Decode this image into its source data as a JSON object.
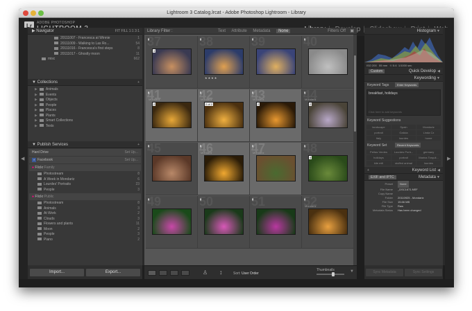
{
  "window": {
    "title": "Lightroom 3 Catalog.lrcat - Adobe Photoshop Lightroom - Library"
  },
  "identity": {
    "logo": "Lr",
    "brand_small": "ADOBE PHOTOSHOP",
    "brand_large": "LIGHTROOM 3"
  },
  "modules": [
    "Library",
    "Develop",
    "Slideshow",
    "Print",
    "Web"
  ],
  "active_module": "Library",
  "navigator": {
    "title": "Navigator",
    "zoom_options": "FIT FILL 1:1 3:1"
  },
  "folders": [
    {
      "name": "20111007 - Francesca at Winnie",
      "count": "1"
    },
    {
      "name": "20111009 - Walking to Las Ro...",
      "count": "54"
    },
    {
      "name": "20111016 - Francesca's first steps",
      "count": "8"
    },
    {
      "name": "20111017 - Ghostly moon",
      "count": "11"
    },
    {
      "name": "misc",
      "count": "662"
    }
  ],
  "collections": {
    "title": "Collections",
    "items": [
      "Animals",
      "Events",
      "Objects",
      "People",
      "Places",
      "Plants",
      "Smart Collections",
      "Tests"
    ]
  },
  "publish": {
    "title": "Publish Services",
    "setup": "Set Up...",
    "services": [
      "Hard Drive",
      "Facebook"
    ],
    "flickr_family": {
      "label": "Flickr",
      "sub": "Family",
      "items": [
        {
          "name": "Photostream",
          "count": "8"
        },
        {
          "name": "A Week in Mondariz",
          "count": "6"
        },
        {
          "name": "Lourdes' Portraits",
          "count": "23"
        },
        {
          "name": "People",
          "count": "3"
        }
      ]
    },
    "flickr_public": {
      "label": "Flickr",
      "sub": "Public",
      "items": [
        {
          "name": "Photostream",
          "count": "8"
        },
        {
          "name": "Animals",
          "count": "3"
        },
        {
          "name": "At Work",
          "count": "2"
        },
        {
          "name": "Clouds",
          "count": "3"
        },
        {
          "name": "Flowers and plants",
          "count": "11"
        },
        {
          "name": "Moon",
          "count": "2"
        },
        {
          "name": "People",
          "count": "3"
        },
        {
          "name": "Piano",
          "count": "2"
        }
      ]
    }
  },
  "buttons": {
    "import": "Import...",
    "export": "Export...",
    "sync_metadata": "Sync Metadata",
    "sync_settings": "Sync Settings"
  },
  "filter": {
    "label": "Library Filter :",
    "options": [
      "Text",
      "Attribute",
      "Metadata",
      "None"
    ],
    "selected": "None",
    "off": "Filters Off"
  },
  "grid": [
    {
      "n": "37",
      "c1": "#3a3a52",
      "c2": "#c89060",
      "sel": false,
      "badge": "4",
      "cap": "",
      "stars": "",
      "mark": false
    },
    {
      "n": "38",
      "c1": "#2c3c6a",
      "c2": "#e0a050",
      "sel": false,
      "badge": "",
      "cap": "",
      "stars": "★★★★",
      "mark": false
    },
    {
      "n": "39",
      "c1": "#3a4478",
      "c2": "#e0b060",
      "sel": false,
      "badge": "",
      "cap": "",
      "stars": "",
      "mark": false
    },
    {
      "n": "40",
      "c1": "#8a8a8a",
      "c2": "#c0c0c0",
      "sel": false,
      "badge": "",
      "cap": "",
      "stars": "",
      "mark": true
    },
    {
      "n": "41",
      "c1": "#3a2810",
      "c2": "#e8a838",
      "sel": true,
      "badge": "2",
      "cap": "Mondariz",
      "stars": "",
      "mark": false
    },
    {
      "n": "42",
      "c1": "#4a3010",
      "c2": "#f0b040",
      "sel": true,
      "badge": "2 of 2",
      "cap": "Mondariz",
      "stars": "",
      "mark": false
    },
    {
      "n": "43",
      "c1": "#2a1a08",
      "c2": "#e89830",
      "sel": true,
      "badge": "2",
      "cap": "Mondariz",
      "stars": "",
      "mark": false
    },
    {
      "n": "44",
      "c1": "#4a4438",
      "c2": "#b8a8c8",
      "sel": false,
      "badge": "2",
      "cap": "Mondariz",
      "stars": "",
      "mark": false
    },
    {
      "n": "45",
      "c1": "#5a3828",
      "c2": "#b88868",
      "sel": false,
      "badge": "",
      "cap": "",
      "stars": "",
      "mark": false
    },
    {
      "n": "46",
      "c1": "#2a1c08",
      "c2": "#f0a830",
      "sel": true,
      "badge": "",
      "cap": "Mondariz",
      "stars": "",
      "mark": false
    },
    {
      "n": "47",
      "c1": "#6a5030",
      "c2": "#4a6a30",
      "sel": true,
      "badge": "",
      "cap": "Mondariz",
      "stars": "",
      "mark": false
    },
    {
      "n": "48",
      "c1": "#2a4a1a",
      "c2": "#6a8a3a",
      "sel": false,
      "badge": "4",
      "cap": "",
      "stars": "",
      "mark": false
    },
    {
      "n": "49",
      "c1": "#1a4a1a",
      "c2": "#c848a8",
      "sel": false,
      "badge": "",
      "cap": "",
      "stars": "",
      "mark": false
    },
    {
      "n": "50",
      "c1": "#1a3a1a",
      "c2": "#d858b8",
      "sel": false,
      "badge": "",
      "cap": "",
      "stars": "",
      "mark": false
    },
    {
      "n": "51",
      "c1": "#183a18",
      "c2": "#b838a0",
      "sel": false,
      "badge": "",
      "cap": "",
      "stars": "",
      "mark": false
    },
    {
      "n": "52",
      "c1": "#4a3010",
      "c2": "#e8a040",
      "sel": false,
      "badge": "",
      "cap": "Mondariz",
      "stars": "",
      "mark": false
    }
  ],
  "toolbar": {
    "sort_label": "Sort:",
    "sort_value": "User Order",
    "thumbnails": "Thumbnails"
  },
  "histogram": {
    "title": "Histogram",
    "iso": "ISO 200",
    "focal": "55 mm",
    "aperture": "f / 5.6",
    "shutter": "1/1000 sec"
  },
  "quick_develop": {
    "title": "Quick Develop",
    "preset": "Custom"
  },
  "keywording": {
    "title": "Keywording",
    "tags_label": "Keyword Tags",
    "tags_mode": "Enter Keywords",
    "tags_value": "breakfast, holidays",
    "placeholder": "Click here to add keywords",
    "suggestions_label": "Keyword Suggestions",
    "suggestions": [
      "landscape",
      "Spain",
      "Mondariz",
      "portrait",
      "Galicia",
      "Linda Cz",
      "Italy",
      "lourdes",
      "home"
    ],
    "set_label": "Keyword Set",
    "set_value": "Recent Keywords",
    "set_items": [
      "Peñas Verdes",
      "Lourdes Portr...",
      "germany",
      "holidays",
      "portrait",
      "Marina Torquil...",
      "kite mill",
      "stuffed animal",
      "lourdes"
    ]
  },
  "keyword_list": {
    "title": "Keyword List"
  },
  "metadata": {
    "title": "Metadata",
    "mode": "EXIF and IPTC",
    "preset_label": "Preset",
    "preset_value": "None",
    "fields": [
      {
        "k": "File Name",
        "v": "_DSC1671.NEF"
      },
      {
        "k": "Copy Name",
        "v": ""
      },
      {
        "k": "Folder",
        "v": "20110925 - Mondariz"
      },
      {
        "k": "File Size",
        "v": "15.66 MB"
      },
      {
        "k": "File Type",
        "v": "Raw"
      },
      {
        "k": "Metadata Status",
        "v": "Has been changed"
      }
    ]
  },
  "colors": {
    "panel": "#383838",
    "grid_bg": "#565656",
    "selected_cell": "#6a6a6a",
    "text": "#b8b8b8"
  }
}
